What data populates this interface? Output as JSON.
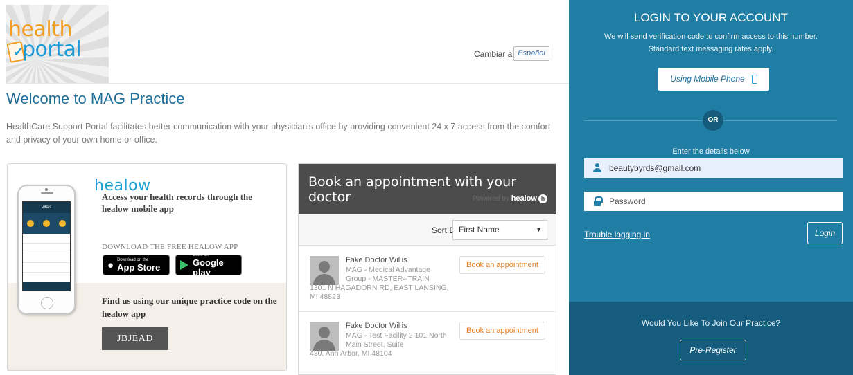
{
  "header": {
    "logo_line1": "health",
    "logo_line2": "portal",
    "lang_prefix": "Cambiar a",
    "lang_button": "Español"
  },
  "welcome": {
    "title": "Welcome to MAG Practice",
    "intro": "HealthCare Support Portal facilitates better communication with your physician's office by providing convenient 24 x 7 access from the comfort and privacy of your own home or office."
  },
  "healow": {
    "brand": "healow",
    "tagline": "Access your health records through the healow mobile app",
    "download_label": "DOWNLOAD THE FREE HEALOW APP",
    "app_store_small": "Download on the",
    "app_store_big": "App Store",
    "google_small": "Get it on",
    "google_big": "Google play",
    "find_us": "Find us using our unique practice code on the healow app",
    "practice_code": "JBJEAD",
    "phone_title": "Vitals"
  },
  "appointment": {
    "title": "Book an appointment with your doctor",
    "powered_prefix": "Powered by",
    "powered_brand": "healow",
    "sort_label": "Sort By:",
    "sort_value": "First Name",
    "doctors": [
      {
        "name": "Fake Doctor Willis",
        "org": "MAG - Medical Advantage Group - MASTER--TRAIN",
        "address": "1301 N HAGADORN RD, EAST LANSING, MI 48823",
        "button": "Book an appointment"
      },
      {
        "name": "Fake Doctor Willis",
        "org": "MAG - Test Facility 2 101 North Main Street, Suite",
        "address": "430, Ann Arbor, MI 48104",
        "button": "Book an appointment"
      }
    ]
  },
  "login": {
    "title": "LOGIN TO YOUR ACCOUNT",
    "sub1": "We will send verification code to confirm access to this number.",
    "sub2": "Standard text messaging rates apply.",
    "mobile_button": "Using Mobile Phone",
    "or_label": "OR",
    "enter_label": "Enter the details below",
    "email_value": "beautybyrds@gmail.com",
    "password_placeholder": "Password",
    "trouble_link": "Trouble logging in",
    "login_button": "Login",
    "join_label": "Would You Like To Join Our Practice?",
    "prereg_button": "Pre-Register"
  },
  "colors": {
    "panel": "#207ea5",
    "panel_dark": "#155c7e",
    "title_blue": "#1f6f9a",
    "book_orange": "#e87c1e"
  }
}
